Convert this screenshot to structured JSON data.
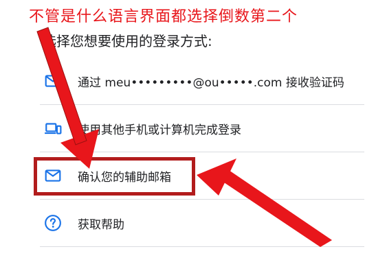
{
  "annotation": {
    "note": "不管是什么语言界面都选择倒数第二个",
    "color": "#e8161b",
    "highlight_color": "#b21c1c"
  },
  "prompt": "选择您想要使用的登录方式:",
  "options": [
    {
      "icon": "mail-icon",
      "label": "通过 meu•••••••••@ou•••••.com 接收验证码"
    },
    {
      "icon": "devices-icon",
      "label": "使用其他手机或计算机完成登录"
    },
    {
      "icon": "mail-icon",
      "label": "确认您的辅助邮箱"
    },
    {
      "icon": "help-icon",
      "label": "获取帮助"
    }
  ],
  "colors": {
    "icon_blue": "#1a73e8",
    "text": "#202124",
    "divider": "#dadce0"
  }
}
